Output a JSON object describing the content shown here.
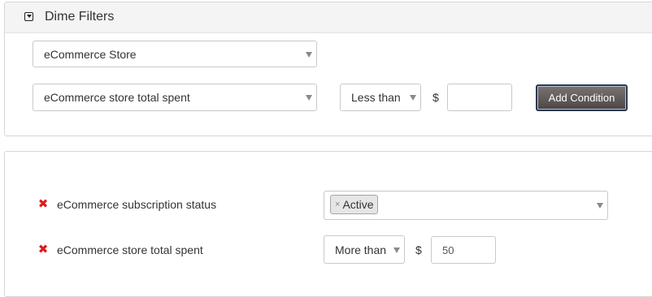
{
  "panel": {
    "title": "Dime Filters",
    "source_select": "eCommerce Store",
    "field_select": "eCommerce store total spent",
    "operator_select": "Less than",
    "currency": "$",
    "amount_value": "",
    "add_button": "Add Condition"
  },
  "conditions": [
    {
      "label": "eCommerce subscription status",
      "tag": "Active",
      "tag_remove": "×"
    },
    {
      "label": "eCommerce store total spent",
      "operator": "More than",
      "currency": "$",
      "value": "50"
    }
  ],
  "icons": {
    "remove": "✖"
  }
}
